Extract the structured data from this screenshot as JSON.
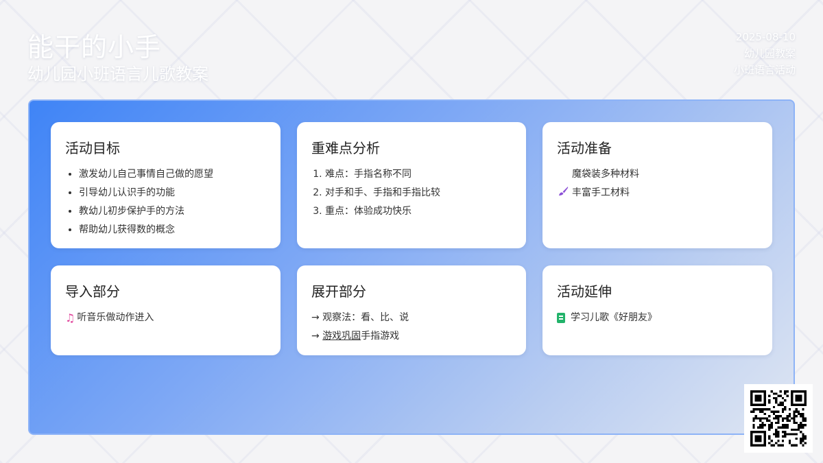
{
  "header": {
    "title": "能干的小手",
    "subtitle": "幼儿园小班语言儿歌教案"
  },
  "meta": {
    "date": "2025-08-10",
    "category": "幼儿园教案",
    "activity": "小班语言活动"
  },
  "cards": {
    "goals": {
      "title": "活动目标",
      "items": [
        "激发幼儿自己事情自己做的愿望",
        "引导幼儿认识手的功能",
        "教幼儿初步保护手的方法",
        "帮助幼儿获得数的概念"
      ]
    },
    "key_points": {
      "title": "重难点分析",
      "items": [
        "难点：手指名称不同",
        "对手和手、手指和手指比较",
        "重点：体验成功快乐"
      ]
    },
    "preparation": {
      "title": "活动准备",
      "item1": "魔袋装多种材料",
      "item2": "丰富手工材料",
      "item2_icon": "paintbrush-icon"
    },
    "intro": {
      "title": "导入部分",
      "item1": "听音乐做动作进入",
      "item1_icon": "music-note-icon"
    },
    "development": {
      "title": "展开部分",
      "line1": "→ 观察法：看、比、说",
      "line2_prefix": "→ ",
      "line2_link": "游戏巩固",
      "line2_suffix": "手指游戏"
    },
    "extension": {
      "title": "活动延伸",
      "item1": "学习儿歌《好朋友》",
      "item1_icon": "book-icon"
    }
  },
  "colors": {
    "panel_start": "#3f84f6",
    "panel_end": "#dfe6f3",
    "music_icon": "#e0429a",
    "brush_icon": "#8b4fd6",
    "book_icon": "#22b36a"
  }
}
